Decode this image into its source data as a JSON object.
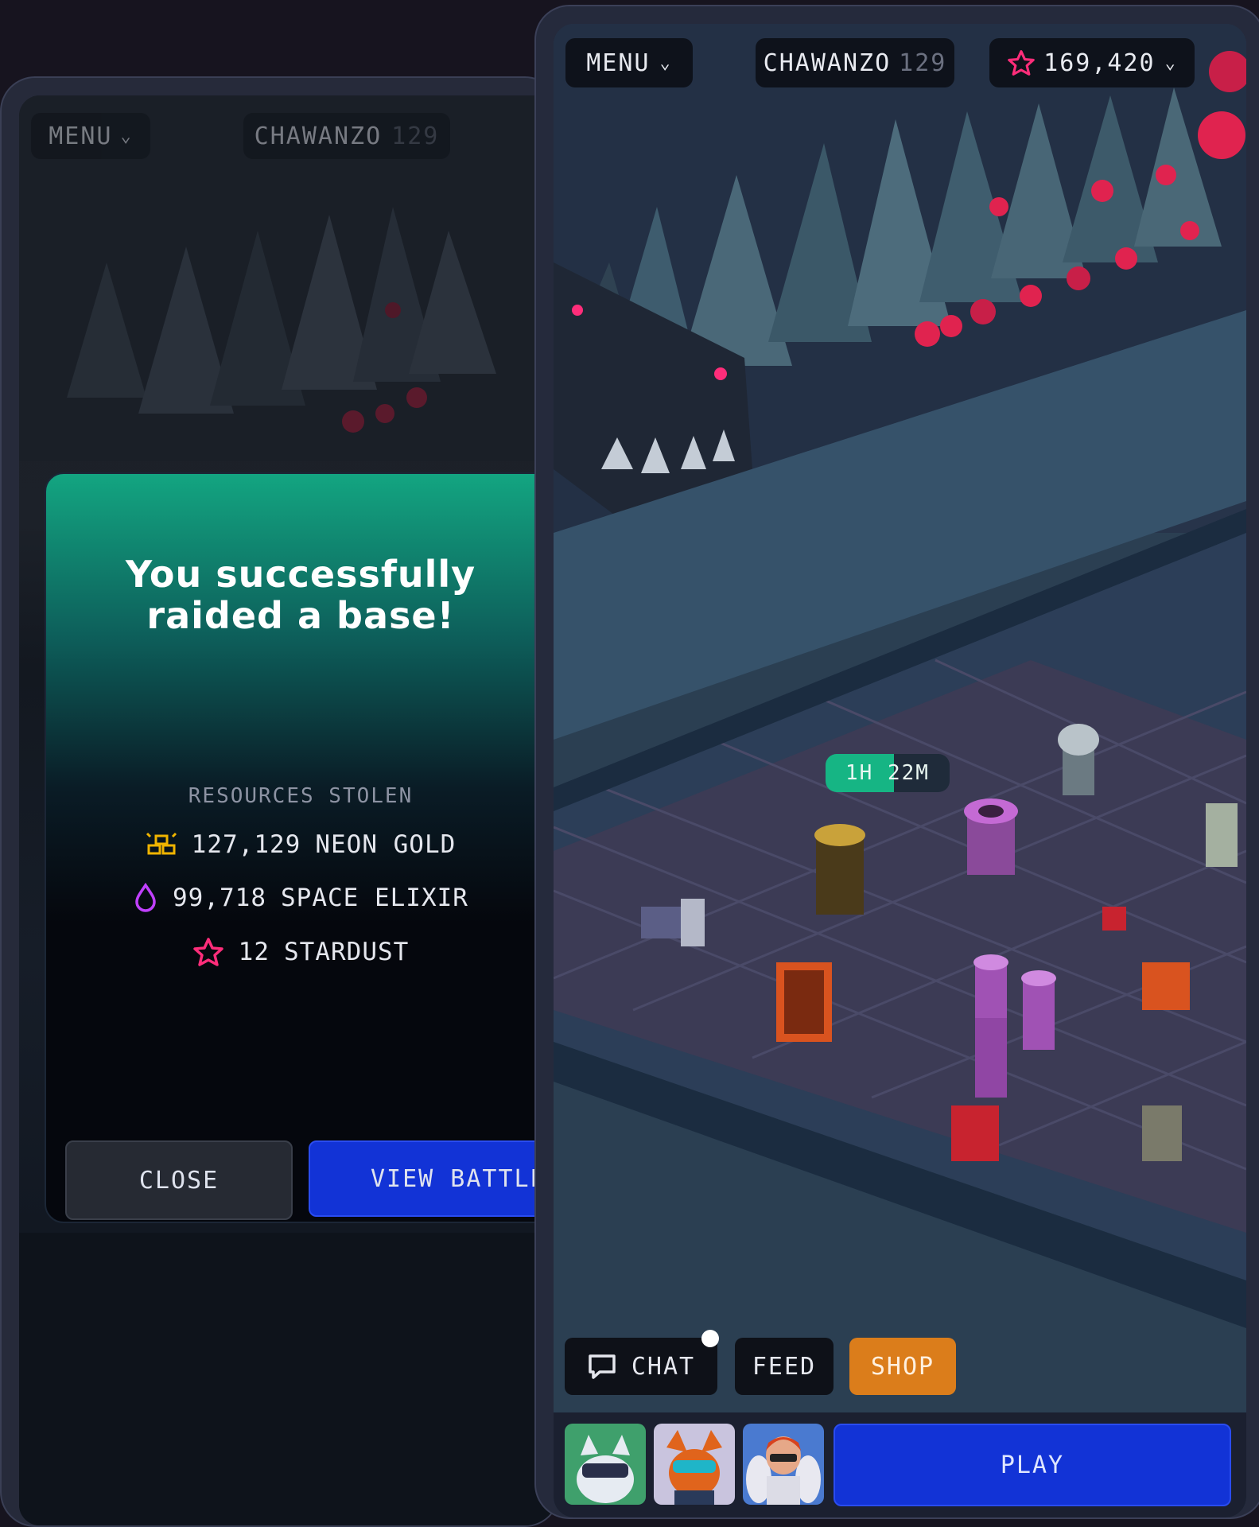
{
  "left_screen": {
    "menu_label": "MENU",
    "player_name": "CHAWANZO",
    "player_level": "129",
    "raid_modal": {
      "title_line1": "You successfully",
      "title_line2": "raided a base!",
      "resources_heading": "RESOURCES STOLEN",
      "resources": [
        {
          "amount": "127,129",
          "name": "NEON GOLD",
          "icon": "gold-bars-icon",
          "color": "#f0b400"
        },
        {
          "amount": "99,718",
          "name": "SPACE ELIXIR",
          "icon": "elixir-drop-icon",
          "color": "#c040ff"
        },
        {
          "amount": "12",
          "name": "STARDUST",
          "icon": "stardust-star-icon",
          "color": "#ff2d7a"
        }
      ],
      "close_label": "CLOSE",
      "view_battle_label": "VIEW BATTLE"
    }
  },
  "right_screen": {
    "menu_label": "MENU",
    "player_name": "CHAWANZO",
    "player_level": "129",
    "stardust_total": "169,420",
    "timer_label": "1H 22M",
    "chat_label": "CHAT",
    "feed_label": "FEED",
    "shop_label": "SHOP",
    "play_label": "PLAY",
    "avatars": [
      "raccoon-avatar",
      "fox-avatar",
      "angel-avatar"
    ]
  },
  "colors": {
    "accent_blue": "#1233d6",
    "shop_orange": "#db7d1b",
    "timer_green": "#16b584",
    "stardust_pink": "#ff2d7a"
  }
}
